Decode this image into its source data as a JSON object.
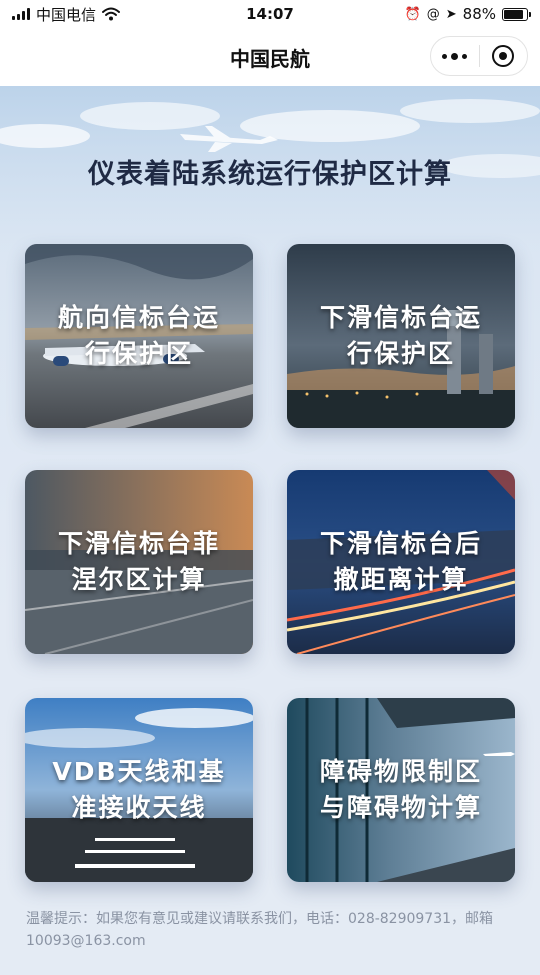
{
  "status_bar": {
    "carrier": "中国电信",
    "time": "14:07",
    "battery": "88%",
    "battery_level": 0.88,
    "icons": [
      "signal-icon",
      "wifi-icon",
      "alarm-icon",
      "orientation-lock-icon",
      "location-arrow-icon",
      "battery-icon"
    ]
  },
  "nav": {
    "title": "中国民航",
    "icons": [
      "more-dots-icon",
      "close-target-icon"
    ]
  },
  "page": {
    "title": "仪表着陆系统运行保护区计算",
    "title_underline_color": "#efd9b8"
  },
  "cards": [
    {
      "label_line1": "航向信标台运",
      "label_line2": "行保护区"
    },
    {
      "label_line1": "下滑信标台运",
      "label_line2": "行保护区"
    },
    {
      "label_line1": "下滑信标台菲",
      "label_line2": "涅尔区计算"
    },
    {
      "label_line1": "下滑信标台后",
      "label_line2": "撤距离计算"
    },
    {
      "label_line1": "VDB天线和基",
      "label_line2": "准接收天线"
    },
    {
      "label_line1": "障碍物限制区",
      "label_line2": "与障碍物计算"
    }
  ],
  "footer": {
    "text": "温馨提示：如果您有意见或建议请联系我们，电话：028-82909731，邮箱10093@163.com"
  }
}
